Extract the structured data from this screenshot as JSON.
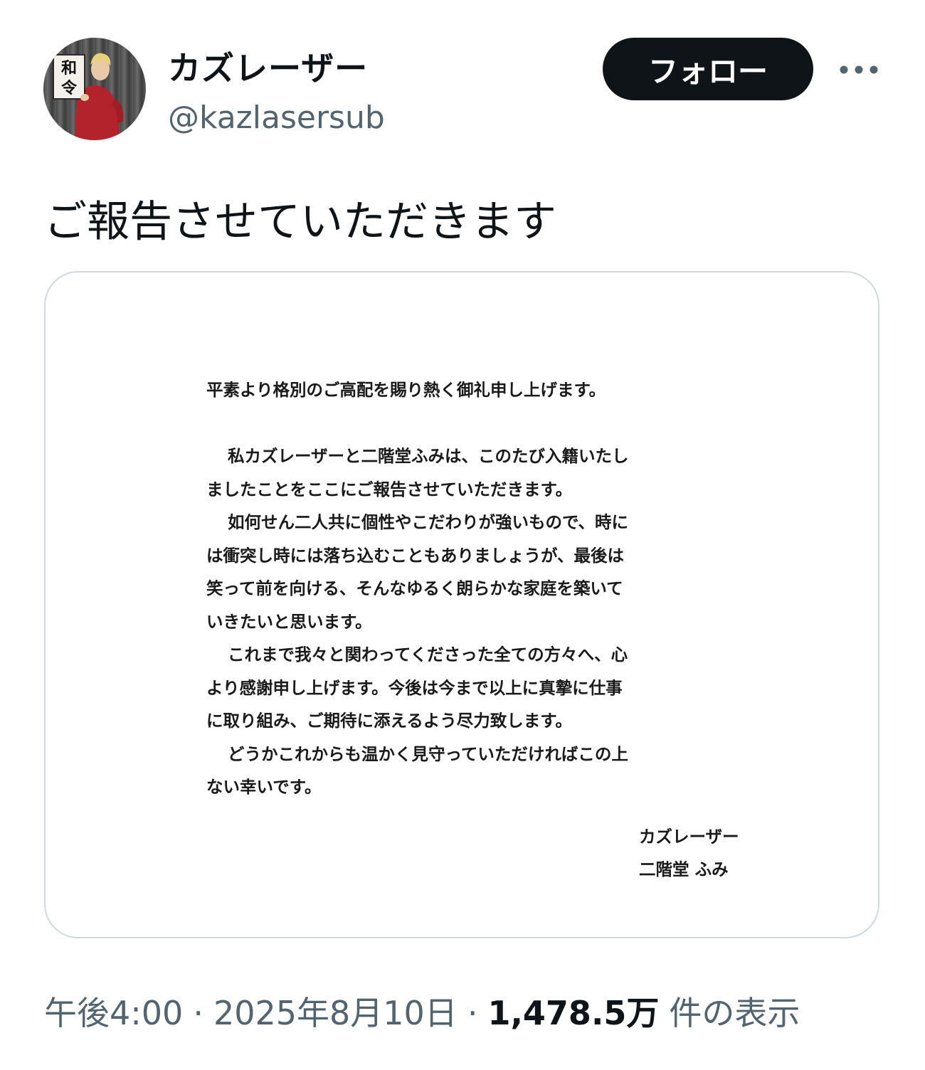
{
  "user": {
    "display_name": "カズレーザー",
    "handle": "@kazlasersub",
    "avatar_sign_chars": [
      "和",
      "令"
    ]
  },
  "actions": {
    "follow_label": "フォロー",
    "more_icon": "more-horizontal-icon"
  },
  "tweet": {
    "text": "ご報告させていただきます"
  },
  "letter": {
    "opening": "平素より格別のご高配を賜り熱く御礼申し上げます。",
    "paragraphs": [
      [
        "私カズレーザーと二階堂ふみは、このたび入籍いたし",
        "ましたことをここにご報告させていただきます。"
      ],
      [
        "如何せん二人共に個性やこだわりが強いもので、時に",
        "は衝突し時には落ち込むこともありましょうが、最後は",
        "笑って前を向ける、そんなゆるく朗らかな家庭を築いて",
        "いきたいと思います。"
      ],
      [
        "これまで我々と関わってくださった全ての方々へ、心",
        "より感謝申し上げます。今後は今まで以上に真摯に仕事",
        "に取り組み、ご期待に添えるよう尽力致します。"
      ],
      [
        "どうかこれからも温かく見守っていただければこの上",
        "ない幸いです。"
      ]
    ],
    "signatures": [
      "カズレーザー",
      "二階堂 ふみ"
    ]
  },
  "meta": {
    "time": "午後4:00",
    "separator": "·",
    "date": "2025年8月10日",
    "views_count": "1,478.5万",
    "views_label": "件の表示"
  },
  "colors": {
    "text_primary": "#0f1419",
    "text_secondary": "#536471",
    "border": "#cfd9de",
    "follow_bg": "#0f1419",
    "avatar_sweater": "#b3232b"
  }
}
